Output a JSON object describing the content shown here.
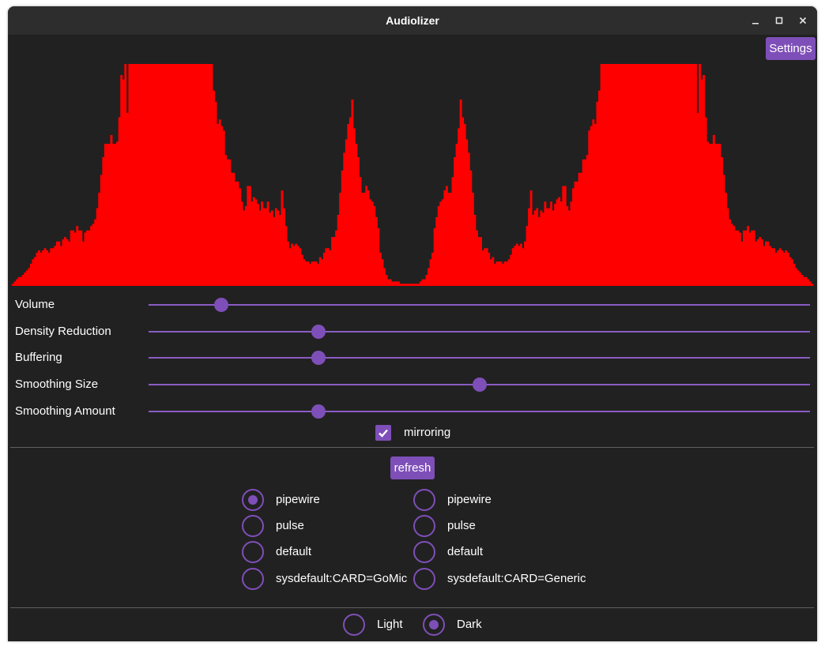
{
  "window": {
    "title": "Audiolizer"
  },
  "buttons": {
    "settings": "Settings",
    "refresh": "refresh"
  },
  "colors": {
    "accent": "#7e4fb8",
    "background": "#212121",
    "visualizer": "#ff0000"
  },
  "visualizer": {
    "levels": [
      1,
      2,
      3,
      4,
      4,
      5,
      6,
      7,
      8,
      10,
      12,
      13,
      15,
      16,
      15,
      16,
      17,
      16,
      15,
      17,
      17,
      18,
      20,
      20,
      18,
      21,
      22,
      21,
      20,
      25,
      25,
      24,
      27,
      25,
      25,
      20,
      24,
      25,
      25,
      27,
      28,
      30,
      35,
      42,
      50,
      58,
      64,
      64,
      64,
      68,
      64,
      64,
      65,
      76,
      95,
      93,
      100,
      78,
      100,
      100,
      100,
      100,
      100,
      100,
      100,
      100,
      100,
      100,
      100,
      100,
      100,
      100,
      100,
      100,
      100,
      100,
      100,
      100,
      100,
      100,
      100,
      100,
      100,
      100,
      100,
      100,
      100,
      100,
      100,
      100,
      100,
      100,
      100,
      100,
      100,
      100,
      100,
      100,
      100,
      100,
      88,
      83,
      73,
      75,
      72,
      70,
      59,
      57,
      57,
      51,
      51,
      47,
      47,
      44,
      38,
      34,
      36,
      45,
      45,
      38,
      40,
      39,
      37,
      34,
      38,
      35,
      35,
      38,
      33,
      34,
      31,
      35,
      34,
      32,
      43,
      35,
      27,
      20,
      17,
      19,
      18,
      19,
      18,
      17,
      14,
      12,
      11,
      11,
      10,
      11,
      11,
      11,
      10,
      13,
      12,
      15,
      17,
      17,
      16,
      22,
      22,
      25,
      32,
      42,
      52,
      60,
      66,
      73,
      76,
      84,
      71,
      64,
      58,
      49,
      42,
      42,
      45,
      43,
      39,
      38,
      36,
      31,
      26,
      15,
      12,
      8,
      5,
      3,
      3,
      2,
      2,
      2,
      2,
      1,
      1,
      1,
      1,
      1,
      1,
      1,
      1,
      1,
      1,
      2,
      3,
      3,
      5,
      8,
      12,
      15,
      26,
      31,
      36,
      38,
      39,
      43,
      45,
      42,
      42,
      49,
      58,
      64,
      71,
      84,
      76,
      73,
      66,
      60,
      52,
      42,
      32,
      25,
      22,
      22,
      16,
      17,
      17,
      15,
      12,
      13,
      10,
      11,
      11,
      11,
      10,
      11,
      11,
      12,
      14,
      17,
      18,
      19,
      18,
      19,
      17,
      20,
      27,
      35,
      43,
      32,
      34,
      35,
      31,
      34,
      33,
      38,
      35,
      35,
      38,
      34,
      37,
      39,
      40,
      38,
      45,
      45,
      36,
      34,
      38,
      44,
      47,
      47,
      51,
      51,
      57,
      57,
      59,
      70,
      72,
      75,
      73,
      83,
      88,
      100,
      100,
      100,
      100,
      100,
      100,
      100,
      100,
      100,
      100,
      100,
      100,
      100,
      100,
      100,
      100,
      100,
      100,
      100,
      100,
      100,
      100,
      100,
      100,
      100,
      100,
      100,
      100,
      100,
      100,
      100,
      100,
      100,
      100,
      100,
      100,
      100,
      100,
      100,
      100,
      100,
      100,
      100,
      100,
      100,
      100,
      100,
      100,
      78,
      100,
      93,
      95,
      76,
      65,
      64,
      64,
      68,
      64,
      64,
      64,
      58,
      50,
      42,
      35,
      30,
      28,
      27,
      25,
      25,
      24,
      20,
      25,
      25,
      27,
      24,
      25,
      25,
      20,
      21,
      22,
      21,
      18,
      20,
      20,
      18,
      17,
      17,
      15,
      16,
      17,
      16,
      15,
      16,
      15,
      13,
      12,
      10,
      8,
      7,
      6,
      5,
      4,
      4,
      3,
      2,
      1
    ]
  },
  "sliders": [
    {
      "label": "Volume",
      "value": 0.11
    },
    {
      "label": "Density Reduction",
      "value": 0.257
    },
    {
      "label": "Buffering",
      "value": 0.257
    },
    {
      "label": "Smoothing Size",
      "value": 0.5
    },
    {
      "label": "Smoothing Amount",
      "value": 0.257
    }
  ],
  "mirroring": {
    "label": "mirroring",
    "checked": true
  },
  "devices": {
    "left": [
      {
        "label": "pipewire",
        "selected": true
      },
      {
        "label": "pulse",
        "selected": false
      },
      {
        "label": "default",
        "selected": false
      },
      {
        "label": "sysdefault:CARD=GoMic",
        "selected": false
      }
    ],
    "right": [
      {
        "label": "pipewire",
        "selected": false
      },
      {
        "label": "pulse",
        "selected": false
      },
      {
        "label": "default",
        "selected": false
      },
      {
        "label": "sysdefault:CARD=Generic",
        "selected": false
      }
    ]
  },
  "theme": [
    {
      "label": "Light",
      "selected": false
    },
    {
      "label": "Dark",
      "selected": true
    }
  ],
  "icons": {
    "minimize": "minimize-icon",
    "maximize": "maximize-icon",
    "close": "close-icon",
    "check": "check-icon"
  }
}
